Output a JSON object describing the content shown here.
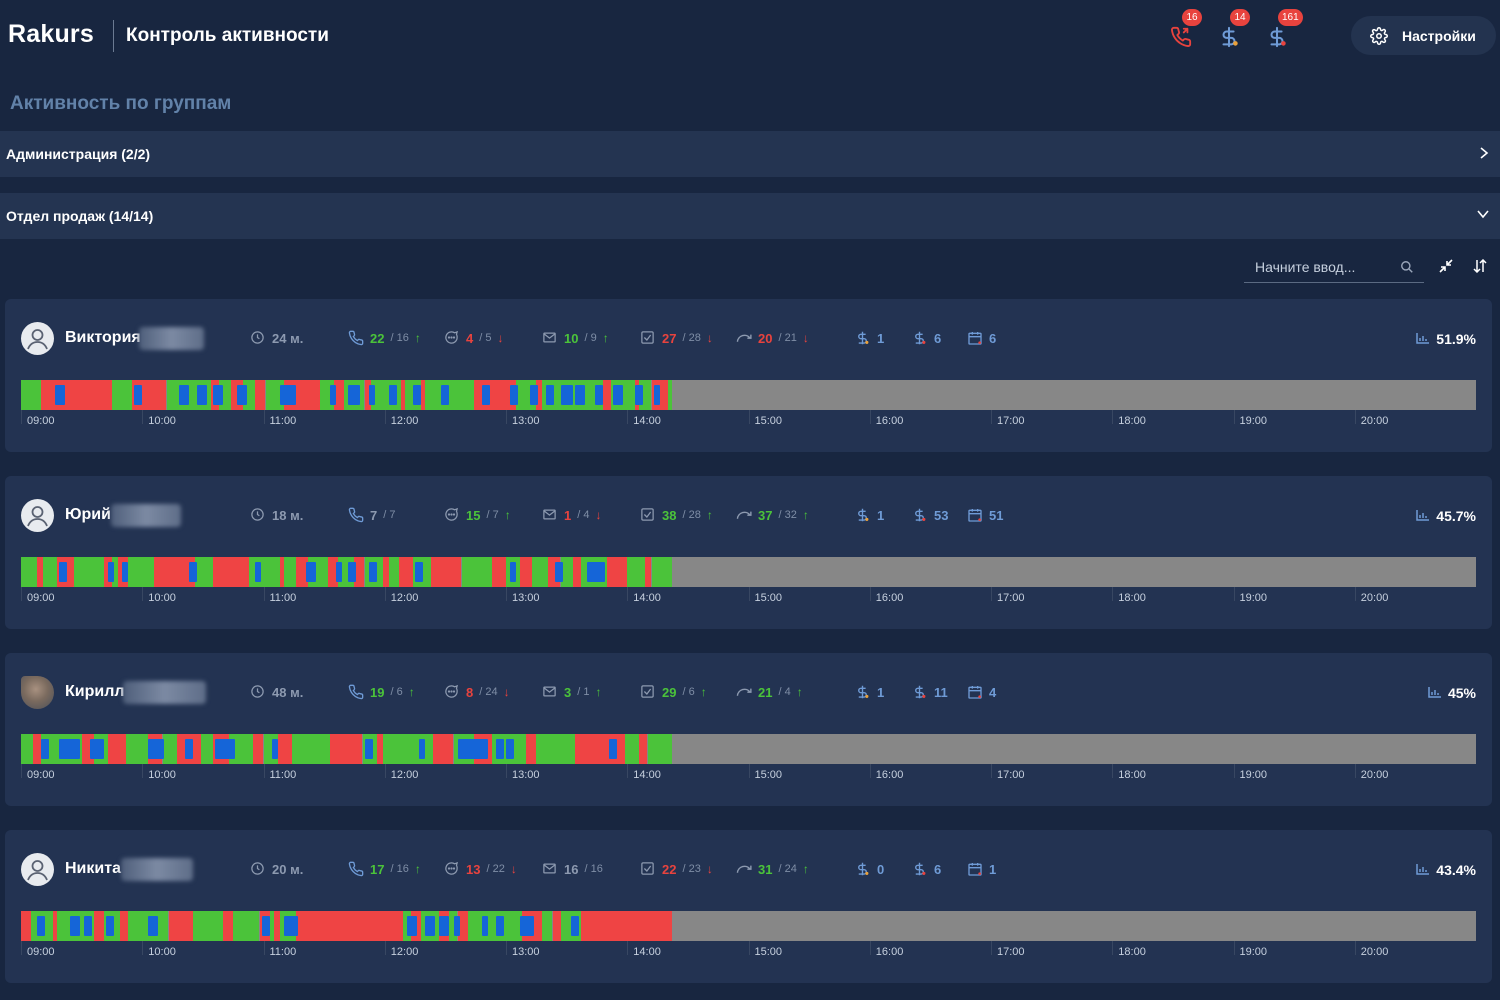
{
  "header": {
    "brand": "Rakurs",
    "title": "Контроль активности",
    "notifications": [
      {
        "icon": "phone-icon",
        "count": "16",
        "color": "#e8433e"
      },
      {
        "icon": "dollar-icon",
        "count": "14",
        "color": "#6f9bd6"
      },
      {
        "icon": "dollar-icon",
        "count": "161",
        "color": "#6f9bd6"
      }
    ],
    "settings_label": "Настройки"
  },
  "section_title": "Активность по группам",
  "groups": [
    {
      "label": "Администрация (2/2)",
      "expanded": false
    },
    {
      "label": "Отдел продаж (14/14)",
      "expanded": true
    }
  ],
  "search": {
    "placeholder": "Начните ввод..."
  },
  "hours": [
    "09:00",
    "10:00",
    "11:00",
    "12:00",
    "13:00",
    "14:00",
    "15:00",
    "16:00",
    "17:00",
    "18:00",
    "19:00",
    "20:00"
  ],
  "colors": {
    "active": "#4bc33a",
    "idle": "#ef4444",
    "call": "#1565d8",
    "off": "#878787",
    "up": "#4bc33a",
    "down": "#e8433e"
  },
  "users": [
    {
      "name": "Виктория",
      "avatar": "default",
      "time": "24 м.",
      "calls": {
        "value": "22",
        "target": "16",
        "trend": "up"
      },
      "chats": {
        "value": "4",
        "target": "5",
        "trend": "down"
      },
      "emails": {
        "value": "10",
        "target": "9",
        "trend": "up"
      },
      "tasks": {
        "value": "27",
        "target": "28",
        "trend": "down"
      },
      "followups": {
        "value": "20",
        "target": "21",
        "trend": "down"
      },
      "deals_a": "1",
      "deals_b": "6",
      "meetings": "6",
      "score": "51.9%",
      "activity_end": "14:22",
      "segments": [
        [
          "09:00",
          "09:10",
          "g"
        ],
        [
          "09:10",
          "09:45",
          "r"
        ],
        [
          "09:45",
          "09:55",
          "g"
        ],
        [
          "09:55",
          "10:12",
          "r"
        ],
        [
          "10:12",
          "10:34",
          "g"
        ],
        [
          "10:34",
          "10:38",
          "r"
        ],
        [
          "10:38",
          "10:44",
          "g"
        ],
        [
          "10:44",
          "10:50",
          "r"
        ],
        [
          "10:50",
          "10:56",
          "g"
        ],
        [
          "10:56",
          "11:01",
          "r"
        ],
        [
          "11:01",
          "11:10",
          "g"
        ],
        [
          "11:10",
          "11:28",
          "r"
        ],
        [
          "11:28",
          "11:35",
          "g"
        ],
        [
          "11:35",
          "11:40",
          "r"
        ],
        [
          "11:40",
          "11:50",
          "g"
        ],
        [
          "11:50",
          "11:53",
          "r"
        ],
        [
          "11:53",
          "12:08",
          "g"
        ],
        [
          "12:08",
          "12:10",
          "r"
        ],
        [
          "12:10",
          "12:18",
          "g"
        ],
        [
          "12:18",
          "12:20",
          "r"
        ],
        [
          "12:20",
          "12:44",
          "g"
        ],
        [
          "12:44",
          "13:05",
          "r"
        ],
        [
          "13:05",
          "13:15",
          "g"
        ],
        [
          "13:15",
          "13:18",
          "r"
        ],
        [
          "13:18",
          "13:48",
          "g"
        ],
        [
          "13:48",
          "13:52",
          "r"
        ],
        [
          "13:52",
          "14:04",
          "g"
        ],
        [
          "14:04",
          "14:06",
          "r"
        ],
        [
          "14:06",
          "14:12",
          "g"
        ],
        [
          "14:12",
          "14:20",
          "r"
        ],
        [
          "14:20",
          "14:22",
          "g"
        ]
      ],
      "calls_marks": [
        [
          "09:17",
          "09:22"
        ],
        [
          "09:56",
          "10:00"
        ],
        [
          "10:18",
          "10:23"
        ],
        [
          "10:27",
          "10:32"
        ],
        [
          "10:35",
          "10:40"
        ],
        [
          "10:47",
          "10:52"
        ],
        [
          "11:08",
          "11:16"
        ],
        [
          "11:33",
          "11:36"
        ],
        [
          "11:42",
          "11:48"
        ],
        [
          "11:52",
          "11:55"
        ],
        [
          "12:02",
          "12:06"
        ],
        [
          "12:14",
          "12:18"
        ],
        [
          "12:28",
          "12:32"
        ],
        [
          "12:48",
          "12:52"
        ],
        [
          "13:02",
          "13:06"
        ],
        [
          "13:12",
          "13:16"
        ],
        [
          "13:20",
          "13:24"
        ],
        [
          "13:27",
          "13:33"
        ],
        [
          "13:34",
          "13:39"
        ],
        [
          "13:44",
          "13:48"
        ],
        [
          "13:53",
          "13:58"
        ],
        [
          "14:04",
          "14:08"
        ],
        [
          "14:13",
          "14:16"
        ]
      ]
    },
    {
      "name": "Юрий",
      "avatar": "default",
      "time": "18 м.",
      "calls": {
        "value": "7",
        "target": "7",
        "trend": "none"
      },
      "chats": {
        "value": "15",
        "target": "7",
        "trend": "up"
      },
      "emails": {
        "value": "1",
        "target": "4",
        "trend": "down"
      },
      "tasks": {
        "value": "38",
        "target": "28",
        "trend": "up"
      },
      "followups": {
        "value": "37",
        "target": "32",
        "trend": "up"
      },
      "deals_a": "1",
      "deals_b": "53",
      "meetings": "51",
      "score": "45.7%",
      "activity_end": "14:22",
      "segments": [
        [
          "09:00",
          "09:08",
          "g"
        ],
        [
          "09:08",
          "09:11",
          "r"
        ],
        [
          "09:11",
          "09:18",
          "g"
        ],
        [
          "09:18",
          "09:26",
          "r"
        ],
        [
          "09:26",
          "09:41",
          "g"
        ],
        [
          "09:41",
          "09:45",
          "r"
        ],
        [
          "09:45",
          "09:48",
          "g"
        ],
        [
          "09:48",
          "09:53",
          "r"
        ],
        [
          "09:53",
          "10:06",
          "g"
        ],
        [
          "10:06",
          "10:26",
          "r"
        ],
        [
          "10:26",
          "10:35",
          "g"
        ],
        [
          "10:35",
          "10:41",
          "r"
        ],
        [
          "10:41",
          "10:53",
          "r"
        ],
        [
          "10:53",
          "11:08",
          "g"
        ],
        [
          "11:08",
          "11:10",
          "r"
        ],
        [
          "11:10",
          "11:16",
          "g"
        ],
        [
          "11:16",
          "11:22",
          "r"
        ],
        [
          "11:22",
          "11:32",
          "g"
        ],
        [
          "11:32",
          "11:37",
          "r"
        ],
        [
          "11:37",
          "11:45",
          "g"
        ],
        [
          "11:45",
          "11:50",
          "r"
        ],
        [
          "11:50",
          "11:59",
          "g"
        ],
        [
          "11:59",
          "12:02",
          "r"
        ],
        [
          "12:02",
          "12:07",
          "g"
        ],
        [
          "12:07",
          "12:14",
          "r"
        ],
        [
          "12:14",
          "12:23",
          "g"
        ],
        [
          "12:23",
          "12:38",
          "r"
        ],
        [
          "12:38",
          "12:53",
          "g"
        ],
        [
          "12:53",
          "13:00",
          "r"
        ],
        [
          "13:00",
          "13:07",
          "g"
        ],
        [
          "13:07",
          "13:13",
          "r"
        ],
        [
          "13:13",
          "13:21",
          "g"
        ],
        [
          "13:21",
          "13:27",
          "r"
        ],
        [
          "13:27",
          "13:33",
          "g"
        ],
        [
          "13:33",
          "13:37",
          "r"
        ],
        [
          "13:37",
          "13:50",
          "g"
        ],
        [
          "13:50",
          "14:00",
          "r"
        ],
        [
          "14:00",
          "14:09",
          "g"
        ],
        [
          "14:09",
          "14:12",
          "r"
        ],
        [
          "14:12",
          "14:22",
          "g"
        ]
      ],
      "calls_marks": [
        [
          "09:19",
          "09:23"
        ],
        [
          "09:43",
          "09:46"
        ],
        [
          "09:50",
          "09:53"
        ],
        [
          "10:23",
          "10:27"
        ],
        [
          "10:56",
          "10:59"
        ],
        [
          "11:21",
          "11:26"
        ],
        [
          "11:36",
          "11:39"
        ],
        [
          "11:42",
          "11:46"
        ],
        [
          "11:52",
          "11:56"
        ],
        [
          "12:15",
          "12:19"
        ],
        [
          "13:02",
          "13:05"
        ],
        [
          "13:24",
          "13:28"
        ],
        [
          "13:40",
          "13:49"
        ]
      ]
    },
    {
      "name": "Кирилл",
      "avatar": "photo",
      "time": "48 м.",
      "calls": {
        "value": "19",
        "target": "6",
        "trend": "up"
      },
      "chats": {
        "value": "8",
        "target": "24",
        "trend": "down"
      },
      "emails": {
        "value": "3",
        "target": "1",
        "trend": "up"
      },
      "tasks": {
        "value": "29",
        "target": "6",
        "trend": "up"
      },
      "followups": {
        "value": "21",
        "target": "4",
        "trend": "up"
      },
      "deals_a": "1",
      "deals_b": "11",
      "meetings": "4",
      "score": "45%",
      "activity_end": "14:22",
      "segments": [
        [
          "09:00",
          "09:06",
          "g"
        ],
        [
          "09:06",
          "09:10",
          "r"
        ],
        [
          "09:10",
          "09:30",
          "g"
        ],
        [
          "09:30",
          "09:36",
          "r"
        ],
        [
          "09:36",
          "09:43",
          "g"
        ],
        [
          "09:43",
          "09:52",
          "r"
        ],
        [
          "09:52",
          "10:03",
          "g"
        ],
        [
          "10:03",
          "10:10",
          "r"
        ],
        [
          "10:10",
          "10:17",
          "g"
        ],
        [
          "10:17",
          "10:29",
          "r"
        ],
        [
          "10:29",
          "10:35",
          "g"
        ],
        [
          "10:35",
          "10:43",
          "r"
        ],
        [
          "10:43",
          "10:55",
          "g"
        ],
        [
          "10:55",
          "11:00",
          "r"
        ],
        [
          "11:00",
          "11:07",
          "g"
        ],
        [
          "11:07",
          "11:14",
          "r"
        ],
        [
          "11:14",
          "11:33",
          "g"
        ],
        [
          "11:33",
          "11:49",
          "r"
        ],
        [
          "11:49",
          "11:56",
          "g"
        ],
        [
          "11:56",
          "11:59",
          "r"
        ],
        [
          "11:59",
          "12:24",
          "g"
        ],
        [
          "12:24",
          "12:34",
          "r"
        ],
        [
          "12:34",
          "12:44",
          "g"
        ],
        [
          "12:44",
          "12:53",
          "r"
        ],
        [
          "12:53",
          "13:10",
          "g"
        ],
        [
          "13:10",
          "13:15",
          "r"
        ],
        [
          "13:15",
          "13:34",
          "g"
        ],
        [
          "13:34",
          "13:59",
          "r"
        ],
        [
          "13:59",
          "14:06",
          "g"
        ],
        [
          "14:06",
          "14:10",
          "r"
        ],
        [
          "14:10",
          "14:22",
          "g"
        ]
      ],
      "calls_marks": [
        [
          "09:10",
          "09:14"
        ],
        [
          "09:19",
          "09:29"
        ],
        [
          "09:34",
          "09:41"
        ],
        [
          "10:03",
          "10:11"
        ],
        [
          "10:21",
          "10:25"
        ],
        [
          "10:36",
          "10:46"
        ],
        [
          "11:04",
          "11:07"
        ],
        [
          "11:50",
          "11:54"
        ],
        [
          "12:17",
          "12:20"
        ],
        [
          "12:36",
          "12:51"
        ],
        [
          "12:55",
          "12:59"
        ],
        [
          "13:00",
          "13:04"
        ],
        [
          "13:51",
          "13:55"
        ]
      ]
    },
    {
      "name": "Никита",
      "avatar": "default",
      "time": "20 м.",
      "calls": {
        "value": "17",
        "target": "16",
        "trend": "up"
      },
      "chats": {
        "value": "13",
        "target": "22",
        "trend": "down"
      },
      "emails": {
        "value": "16",
        "target": "16",
        "trend": "none"
      },
      "tasks": {
        "value": "22",
        "target": "23",
        "trend": "down"
      },
      "followups": {
        "value": "31",
        "target": "24",
        "trend": "up"
      },
      "deals_a": "0",
      "deals_b": "6",
      "meetings": "1",
      "score": "43.4%",
      "activity_end": "14:22",
      "segments": [
        [
          "09:00",
          "09:05",
          "r"
        ],
        [
          "09:05",
          "09:16",
          "g"
        ],
        [
          "09:16",
          "09:18",
          "r"
        ],
        [
          "09:18",
          "09:36",
          "g"
        ],
        [
          "09:36",
          "09:41",
          "r"
        ],
        [
          "09:41",
          "09:49",
          "g"
        ],
        [
          "09:49",
          "09:53",
          "r"
        ],
        [
          "09:53",
          "10:13",
          "g"
        ],
        [
          "10:13",
          "10:25",
          "r"
        ],
        [
          "10:25",
          "10:40",
          "g"
        ],
        [
          "10:40",
          "10:45",
          "r"
        ],
        [
          "10:45",
          "10:58",
          "g"
        ],
        [
          "10:58",
          "11:03",
          "r"
        ],
        [
          "11:03",
          "11:05",
          "g"
        ],
        [
          "11:05",
          "11:08",
          "r"
        ],
        [
          "11:08",
          "11:16",
          "g"
        ],
        [
          "11:16",
          "12:09",
          "r"
        ],
        [
          "12:09",
          "12:13",
          "g"
        ],
        [
          "12:13",
          "12:18",
          "r"
        ],
        [
          "12:18",
          "12:27",
          "g"
        ],
        [
          "12:27",
          "12:32",
          "r"
        ],
        [
          "12:32",
          "12:36",
          "g"
        ],
        [
          "12:36",
          "12:41",
          "r"
        ],
        [
          "12:41",
          "13:08",
          "g"
        ],
        [
          "13:08",
          "13:18",
          "r"
        ],
        [
          "13:18",
          "13:23",
          "g"
        ],
        [
          "13:23",
          "13:27",
          "r"
        ],
        [
          "13:27",
          "13:37",
          "g"
        ],
        [
          "13:37",
          "13:49",
          "r"
        ],
        [
          "13:49",
          "14:22",
          "r"
        ]
      ],
      "calls_marks": [
        [
          "09:08",
          "09:12"
        ],
        [
          "09:24",
          "09:29"
        ],
        [
          "09:31",
          "09:35"
        ],
        [
          "09:42",
          "09:46"
        ],
        [
          "10:03",
          "10:08"
        ],
        [
          "10:59",
          "11:03"
        ],
        [
          "11:10",
          "11:17"
        ],
        [
          "12:11",
          "12:16"
        ],
        [
          "12:20",
          "12:25"
        ],
        [
          "12:27",
          "12:32"
        ],
        [
          "12:34",
          "12:37"
        ],
        [
          "12:48",
          "12:51"
        ],
        [
          "12:55",
          "12:59"
        ],
        [
          "13:07",
          "13:14"
        ],
        [
          "13:32",
          "13:36"
        ]
      ]
    }
  ]
}
